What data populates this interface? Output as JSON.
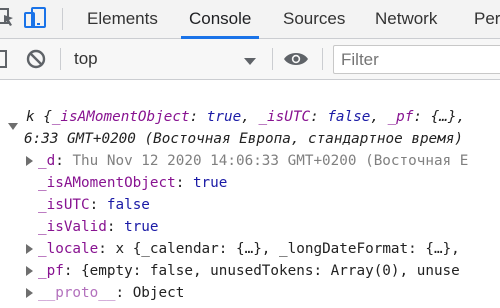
{
  "tabs": [
    {
      "label": "Elements"
    },
    {
      "label": "Console"
    },
    {
      "label": "Sources"
    },
    {
      "label": "Network"
    },
    {
      "label": "Perf"
    }
  ],
  "toolbar": {
    "context": "top",
    "filter_placeholder": "Filter"
  },
  "console": {
    "line1": {
      "prefix": "k {",
      "k1": "_isAMomentObject",
      "v1": "true",
      "k2": "_isUTC",
      "v2": "false",
      "k3": "_pf",
      "v3": "{…}",
      "tail": ","
    },
    "line2": "6:33 GMT+0200 (Восточная Европа, стандартное время)",
    "d": {
      "key": "_d",
      "value": "Thu Nov 12 2020 14:06:33 GMT+0200 (Восточная Е"
    },
    "isAMoment": {
      "key": "_isAMomentObject",
      "value": "true"
    },
    "isUTC": {
      "key": "_isUTC",
      "value": "false"
    },
    "isValid": {
      "key": "_isValid",
      "value": "true"
    },
    "locale": {
      "key": "_locale",
      "value": "x {_calendar: {…}, _longDateFormat: {…},"
    },
    "pf": {
      "key": "_pf",
      "value": "{empty: false, unusedTokens: Array(0), unuse"
    },
    "proto": {
      "key": "__proto__",
      "value": "Object"
    }
  }
}
